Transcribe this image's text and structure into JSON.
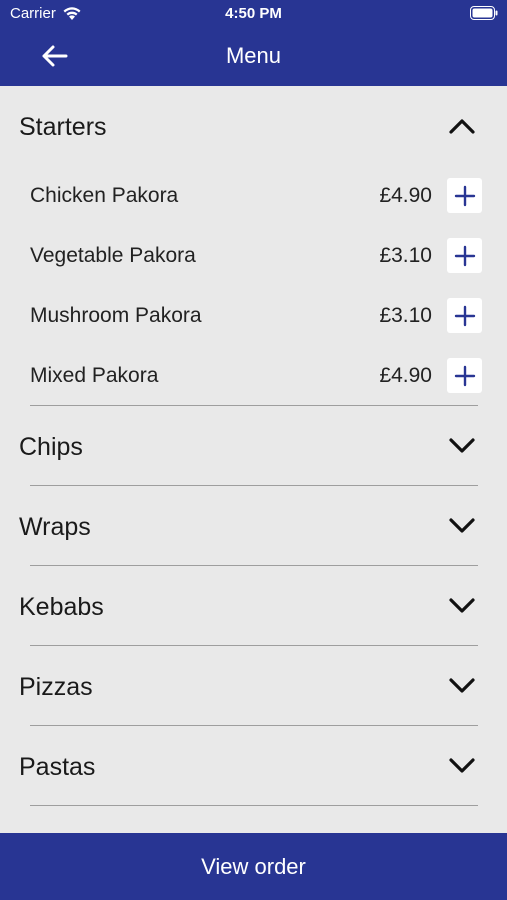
{
  "status_bar": {
    "carrier": "Carrier",
    "time": "4:50 PM",
    "wifi_icon": "wifi-icon",
    "battery_icon": "battery-icon"
  },
  "nav": {
    "title": "Menu",
    "back_icon": "arrow-left-icon"
  },
  "colors": {
    "primary": "#283593",
    "background": "#e9e9e9",
    "add_button_bg": "#ffffff"
  },
  "starters": {
    "label": "Starters",
    "expanded": true,
    "items": [
      {
        "name": "Chicken Pakora",
        "price": "£4.90"
      },
      {
        "name": "Vegetable Pakora",
        "price": "£3.10"
      },
      {
        "name": "Mushroom Pakora",
        "price": "£3.10"
      },
      {
        "name": "Mixed Pakora",
        "price": "£4.90"
      }
    ]
  },
  "collapsed_categories": [
    {
      "label": "Chips"
    },
    {
      "label": "Wraps"
    },
    {
      "label": "Kebabs"
    },
    {
      "label": "Pizzas"
    },
    {
      "label": "Pastas"
    }
  ],
  "footer": {
    "button_label": "View order"
  }
}
